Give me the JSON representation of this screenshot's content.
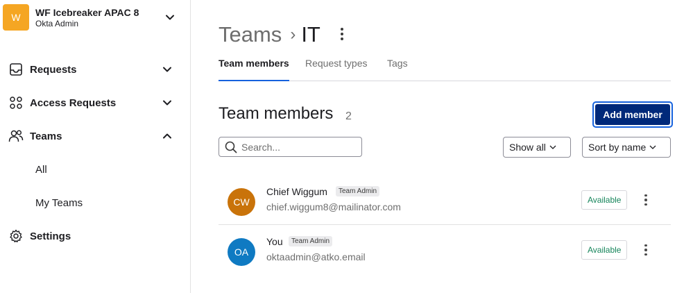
{
  "org": {
    "initial": "W",
    "name": "WF Icebreaker APAC 8",
    "subtitle": "Okta Admin",
    "badge_color": "#f5a623"
  },
  "sidebar": {
    "items": [
      {
        "label": "Requests",
        "icon": "inbox-icon",
        "expanded": false
      },
      {
        "label": "Access Requests",
        "icon": "circles-grid-icon",
        "expanded": false
      },
      {
        "label": "Teams",
        "icon": "people-icon",
        "expanded": true
      },
      {
        "label": "Settings",
        "icon": "gear-icon"
      }
    ],
    "subitems": [
      {
        "label": "All"
      },
      {
        "label": "My Teams"
      }
    ]
  },
  "breadcrumb": {
    "parent": "Teams",
    "separator": "›",
    "current": "IT"
  },
  "tabs": [
    {
      "label": "Team members",
      "active": true
    },
    {
      "label": "Request types",
      "active": false
    },
    {
      "label": "Tags",
      "active": false
    }
  ],
  "section": {
    "title": "Team members",
    "count": "2"
  },
  "toolbar": {
    "add_label": "Add member",
    "search_placeholder": "Search...",
    "filter_label": "Show all",
    "sort_label": "Sort by name"
  },
  "members": [
    {
      "initials": "CW",
      "name": "Chief Wiggum",
      "role": "Team Admin",
      "email": "chief.wiggum8@mailinator.com",
      "status": "Available",
      "avatar_color": "#c9730a"
    },
    {
      "initials": "OA",
      "name": "You",
      "role": "Team Admin",
      "email": "oktaadmin@atko.email",
      "status": "Available",
      "avatar_color": "#0f7ac2"
    }
  ],
  "colors": {
    "accent": "#1662dd",
    "primary_button": "#00297a",
    "status_green": "#16855b"
  }
}
